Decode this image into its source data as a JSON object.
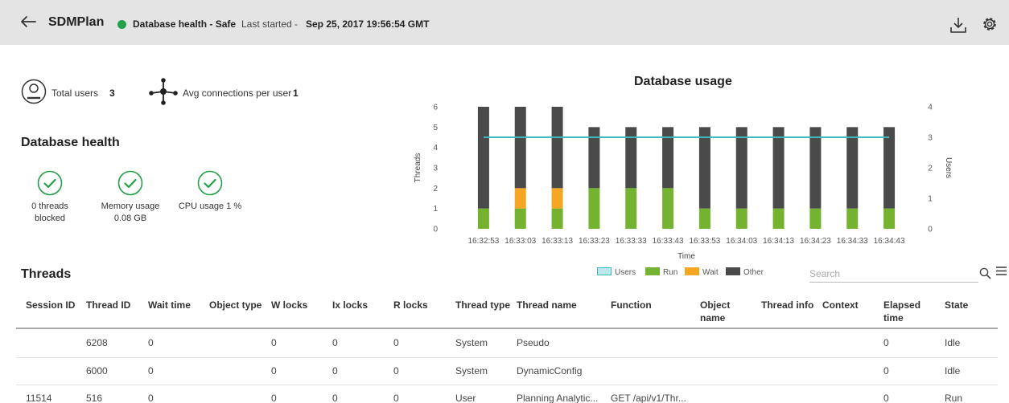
{
  "header": {
    "title": "SDMPlan",
    "health_text": "Database health - Safe",
    "last_started_label": "Last started -",
    "last_started_value": "Sep 25, 2017 19:56:54 GMT",
    "health_color": "#24a148",
    "icons": [
      "back-arrow-icon",
      "download-icon",
      "settings-icon"
    ]
  },
  "summary": {
    "total_users_label": "Total users",
    "total_users_value": "3",
    "avg_connections_label": "Avg connections per user",
    "avg_connections_value": "1"
  },
  "db_health": {
    "title": "Database health",
    "items": [
      {
        "line1": "0 threads",
        "line2": "blocked"
      },
      {
        "line1": "Memory usage",
        "line2": "0.08 GB"
      },
      {
        "line1": "CPU usage 1 %",
        "line2": ""
      }
    ]
  },
  "chart_data": {
    "type": "bar",
    "title": "Database usage",
    "xlabel": "Time",
    "ylabel": "Threads",
    "y2label": "Users",
    "ylim": [
      0,
      6
    ],
    "y2lim": [
      0,
      4
    ],
    "yticks": [
      0,
      1,
      2,
      3,
      4,
      5,
      6
    ],
    "y2ticks": [
      0,
      1,
      2,
      3,
      4
    ],
    "categories": [
      "16:32:53",
      "16:33:03",
      "16:33:13",
      "16:33:23",
      "16:33:33",
      "16:33:43",
      "16:33:53",
      "16:34:03",
      "16:34:13",
      "16:34:23",
      "16:34:33",
      "16:34:43"
    ],
    "stacked": true,
    "series": [
      {
        "name": "Run",
        "color": "#73b330",
        "values": [
          1,
          1,
          1,
          2,
          2,
          2,
          1,
          1,
          1,
          1,
          1,
          1
        ]
      },
      {
        "name": "Wait",
        "color": "#f5a623",
        "values": [
          0,
          1,
          1,
          0,
          0,
          0,
          0,
          0,
          0,
          0,
          0,
          0
        ]
      },
      {
        "name": "Other",
        "color": "#4a4a4a",
        "values": [
          5,
          4,
          4,
          3,
          3,
          3,
          4,
          4,
          4,
          4,
          4,
          4
        ]
      },
      {
        "name": "Users",
        "type": "line",
        "axis": "right",
        "color": "#3fb8c0",
        "values": [
          3,
          3,
          3,
          3,
          3,
          3,
          3,
          3,
          3,
          3,
          3,
          3
        ]
      }
    ],
    "legend": [
      {
        "label": "Users",
        "color": "#bfe6ea",
        "border": "#3fb8c0"
      },
      {
        "label": "Run",
        "color": "#73b330"
      },
      {
        "label": "Wait",
        "color": "#f5a623"
      },
      {
        "label": "Other",
        "color": "#4a4a4a"
      }
    ],
    "legend_position": "bottom"
  },
  "search": {
    "placeholder": "Search"
  },
  "threads": {
    "title": "Threads",
    "columns": [
      {
        "line1": "Session ID",
        "line2": ""
      },
      {
        "line1": "Thread ID",
        "line2": ""
      },
      {
        "line1": "Wait time",
        "line2": ""
      },
      {
        "line1": "Object type",
        "line2": ""
      },
      {
        "line1": "W locks",
        "line2": ""
      },
      {
        "line1": "Ix locks",
        "line2": ""
      },
      {
        "line1": "R locks",
        "line2": ""
      },
      {
        "line1": "Thread type",
        "line2": ""
      },
      {
        "line1": "Thread name",
        "line2": ""
      },
      {
        "line1": "Function",
        "line2": ""
      },
      {
        "line1": "Object",
        "line2": "name"
      },
      {
        "line1": "Thread info",
        "line2": ""
      },
      {
        "line1": "Context",
        "line2": ""
      },
      {
        "line1": "Elapsed",
        "line2": "time"
      },
      {
        "line1": "State",
        "line2": ""
      }
    ],
    "rows": [
      [
        "",
        "6208",
        "0",
        "",
        "0",
        "0",
        "0",
        "System",
        "Pseudo",
        "",
        "",
        "",
        "",
        "0",
        "Idle"
      ],
      [
        "",
        "6000",
        "0",
        "",
        "0",
        "0",
        "0",
        "System",
        "DynamicConfig",
        "",
        "",
        "",
        "",
        "0",
        "Idle"
      ],
      [
        "11514",
        "516",
        "0",
        "",
        "0",
        "0",
        "0",
        "User",
        "Planning Analytic...",
        "GET /api/v1/Thr...",
        "",
        "",
        "",
        "0",
        "Run"
      ]
    ]
  }
}
